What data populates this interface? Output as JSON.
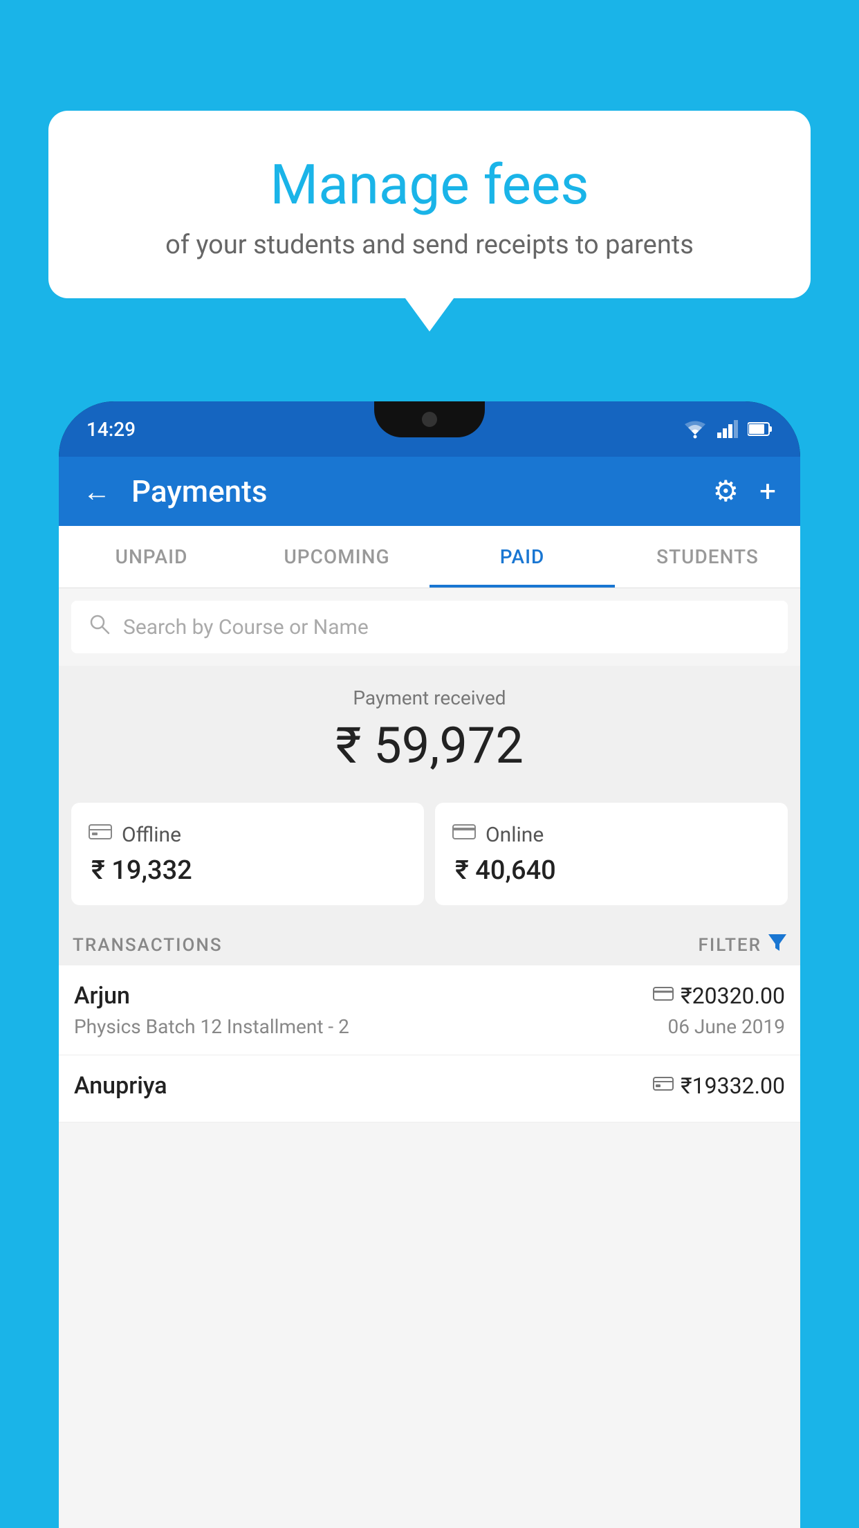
{
  "background_color": "#1ab4e8",
  "bubble": {
    "title": "Manage fees",
    "subtitle": "of your students and send receipts to parents"
  },
  "phone": {
    "status_bar": {
      "time": "14:29"
    },
    "header": {
      "title": "Payments",
      "back_label": "←",
      "gear_label": "⚙",
      "plus_label": "+"
    },
    "tabs": [
      {
        "label": "UNPAID",
        "active": false
      },
      {
        "label": "UPCOMING",
        "active": false
      },
      {
        "label": "PAID",
        "active": true
      },
      {
        "label": "STUDENTS",
        "active": false
      }
    ],
    "search": {
      "placeholder": "Search by Course or Name"
    },
    "payment_received": {
      "label": "Payment received",
      "amount": "₹ 59,972"
    },
    "payment_cards": [
      {
        "type": "offline",
        "label": "Offline",
        "amount": "₹ 19,332",
        "icon": "💳"
      },
      {
        "type": "online",
        "label": "Online",
        "amount": "₹ 40,640",
        "icon": "💳"
      }
    ],
    "transactions_header": {
      "label": "TRANSACTIONS",
      "filter_label": "FILTER"
    },
    "transactions": [
      {
        "name": "Arjun",
        "course": "Physics Batch 12 Installment - 2",
        "amount": "₹20320.00",
        "date": "06 June 2019",
        "payment_type": "online"
      },
      {
        "name": "Anupriya",
        "course": "",
        "amount": "₹19332.00",
        "date": "",
        "payment_type": "offline"
      }
    ]
  }
}
